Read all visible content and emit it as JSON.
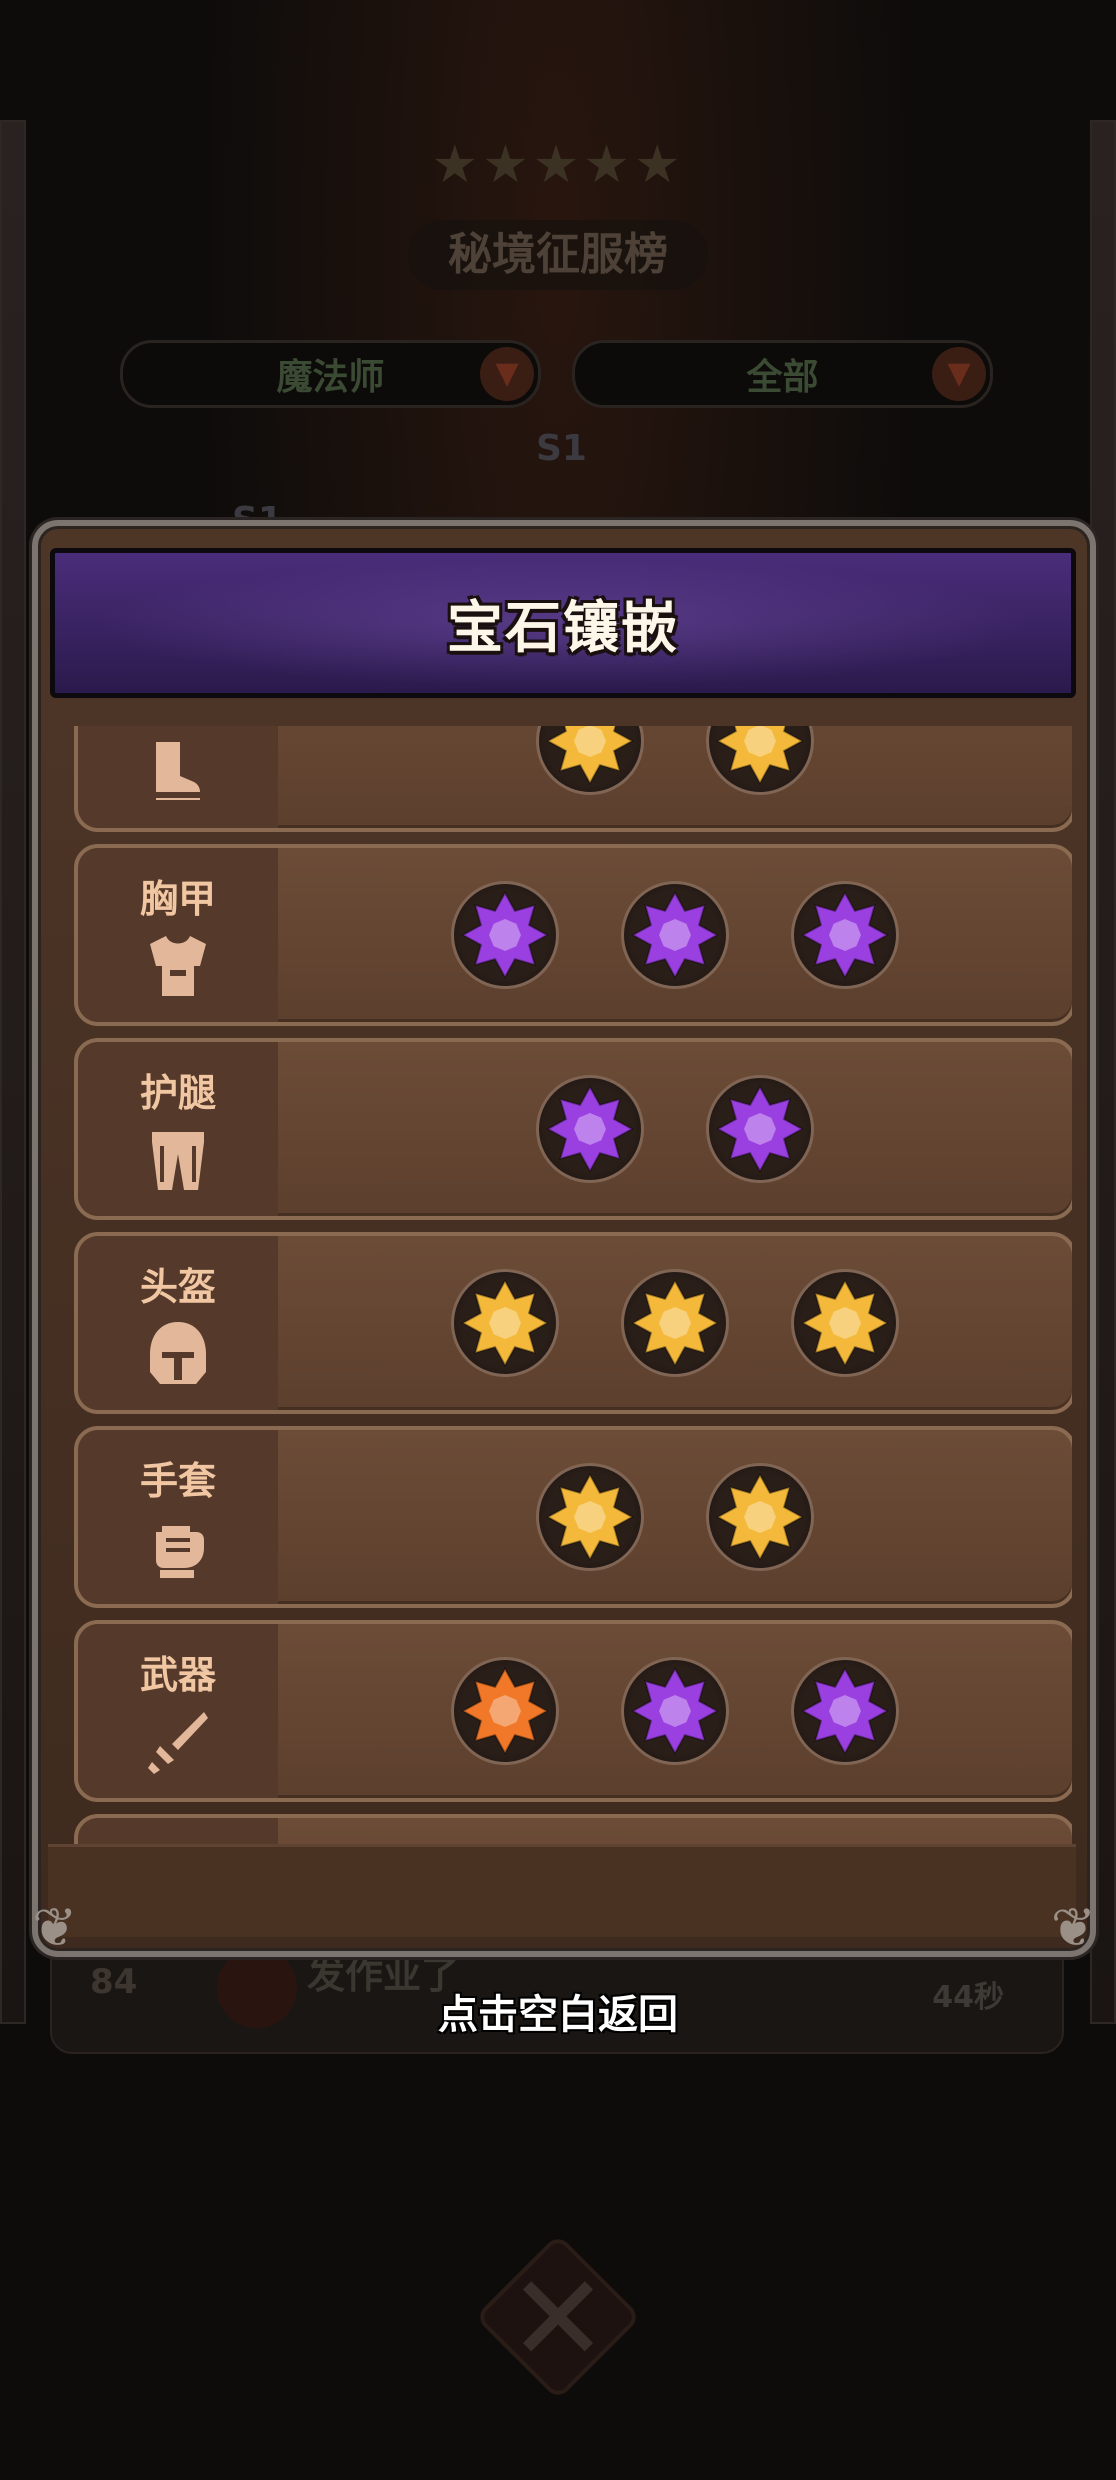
{
  "background": {
    "leaderboard_title": "秘境征服榜",
    "class_filter": "魔法师",
    "scope_filter": "全部",
    "season_labels": [
      "S1",
      "S1"
    ],
    "row": {
      "rank": "84",
      "name": "发作业了",
      "time": "44秒"
    }
  },
  "dialog": {
    "title": "宝石镶嵌",
    "slots": [
      {
        "name": "",
        "icon": "boots-icon",
        "gems": [
          "gold",
          "gold"
        ]
      },
      {
        "name": "胸甲",
        "icon": "chest-armor-icon",
        "gems": [
          "purple",
          "purple",
          "purple"
        ]
      },
      {
        "name": "护腿",
        "icon": "leggings-icon",
        "gems": [
          "purple",
          "purple"
        ]
      },
      {
        "name": "头盔",
        "icon": "helmet-icon",
        "gems": [
          "gold",
          "gold",
          "gold"
        ]
      },
      {
        "name": "手套",
        "icon": "glove-icon",
        "gems": [
          "gold",
          "gold"
        ]
      },
      {
        "name": "武器",
        "icon": "sword-icon",
        "gems": [
          "orange",
          "purple",
          "purple"
        ]
      },
      {
        "name": "",
        "icon": "",
        "gems": []
      }
    ]
  },
  "dismiss_hint": "点击空白返回",
  "colors": {
    "gold": "#f4b93a",
    "purple": "#9a3fe0",
    "orange": "#f07828",
    "label_text": "#f1c7a3"
  }
}
